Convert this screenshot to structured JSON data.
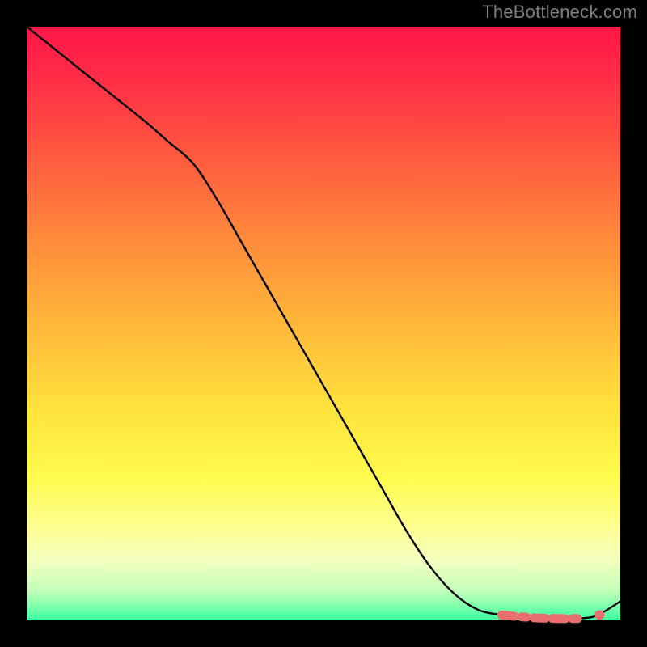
{
  "attribution": "TheBottleneck.com",
  "chart_data": {
    "type": "line",
    "title": "",
    "xlabel": "",
    "ylabel": "",
    "ylim": [
      0,
      100
    ],
    "xlim": [
      0,
      100
    ],
    "series": [
      {
        "name": "main-curve",
        "stroke": "#000000",
        "x": [
          0,
          5,
          10,
          15,
          20,
          24,
          28,
          32,
          36,
          40,
          44,
          48,
          52,
          56,
          60,
          64,
          68,
          72,
          76,
          80,
          83,
          86,
          89,
          92,
          95,
          97,
          100
        ],
        "y": [
          100,
          96,
          92,
          88,
          84,
          80.5,
          77,
          71,
          64,
          57,
          50,
          43,
          36,
          29,
          22,
          15,
          9,
          4.5,
          1.8,
          0.9,
          0.6,
          0.4,
          0.3,
          0.3,
          0.5,
          1.3,
          3.2
        ]
      },
      {
        "name": "highlight-segment",
        "stroke": "#e96e6e",
        "style": "thick-dashed",
        "x": [
          80,
          82,
          84,
          86,
          88,
          90,
          92,
          94
        ],
        "y": [
          0.9,
          0.7,
          0.55,
          0.4,
          0.35,
          0.3,
          0.3,
          0.3
        ]
      },
      {
        "name": "highlight-dot",
        "stroke": "#e96e6e",
        "style": "dot",
        "x": [
          96.5
        ],
        "y": [
          0.9
        ]
      }
    ],
    "colors": {
      "gradient_top": "#ff1647",
      "gradient_bottom": "#3dffa0",
      "frame": "#000000",
      "highlight": "#e96e6e"
    }
  }
}
